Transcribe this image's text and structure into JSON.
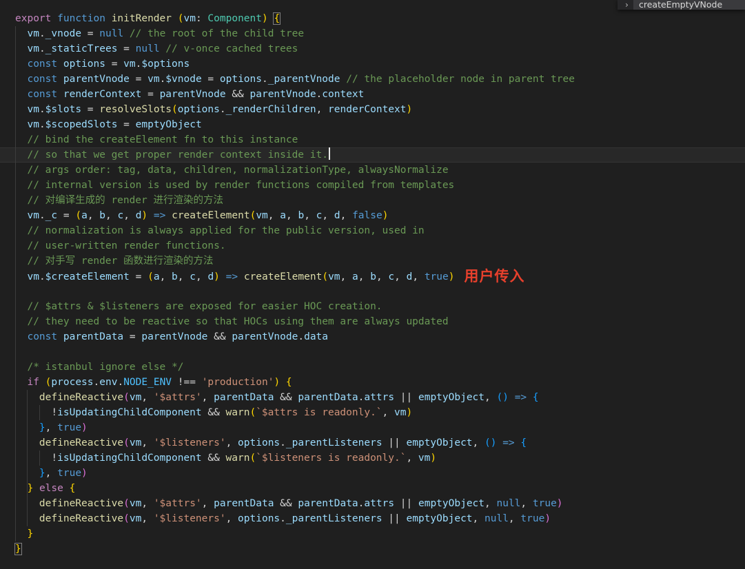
{
  "overlay": {
    "chevron": "›",
    "label": "createEmptyVNode"
  },
  "editor": {
    "cursor_line": 10,
    "palette": {
      "background": "#1f1f1f",
      "pl": "#d4d4d4",
      "cm": "#6a9955",
      "kw": "#569cd6",
      "kw2": "#c586c0",
      "fn": "#dcdcaa",
      "var": "#9cdcfe",
      "type": "#4ec9b0",
      "cons": "#4fc1ff",
      "str": "#ce9178",
      "b1": "#ffd700",
      "b2": "#da70d6",
      "b3": "#179fff",
      "bm": "#ffd700",
      "annot": "#e8402c",
      "cursor": "#e8e8e8",
      "indentGuide": "#3c3c3c",
      "lineHighlightBorder": "#343434"
    },
    "indent_guides": [
      {
        "col": 0,
        "from": 2,
        "to": 35
      },
      {
        "col": 2,
        "from": 26,
        "to": 34
      },
      {
        "col": 4,
        "from": 27,
        "to": 27
      },
      {
        "col": 4,
        "from": 30,
        "to": 30
      }
    ],
    "code_lines": [
      [
        [
          "kw2",
          "export"
        ],
        [
          "pl",
          " "
        ],
        [
          "kw",
          "function"
        ],
        [
          "pl",
          " "
        ],
        [
          "fn",
          "initRender"
        ],
        [
          "pl",
          " "
        ],
        [
          "b1",
          "("
        ],
        [
          "var",
          "vm"
        ],
        [
          "pl",
          ": "
        ],
        [
          "type",
          "Component"
        ],
        [
          "b1",
          ")"
        ],
        [
          "pl",
          " "
        ],
        [
          "bm",
          "{"
        ]
      ],
      [
        [
          "pl",
          "  "
        ],
        [
          "var",
          "vm"
        ],
        [
          "pl",
          "."
        ],
        [
          "var",
          "_vnode"
        ],
        [
          "pl",
          " = "
        ],
        [
          "kw",
          "null"
        ],
        [
          "pl",
          " "
        ],
        [
          "cm",
          "// the root of the child tree"
        ]
      ],
      [
        [
          "pl",
          "  "
        ],
        [
          "var",
          "vm"
        ],
        [
          "pl",
          "."
        ],
        [
          "var",
          "_staticTrees"
        ],
        [
          "pl",
          " = "
        ],
        [
          "kw",
          "null"
        ],
        [
          "pl",
          " "
        ],
        [
          "cm",
          "// v-once cached trees"
        ]
      ],
      [
        [
          "pl",
          "  "
        ],
        [
          "kw",
          "const"
        ],
        [
          "pl",
          " "
        ],
        [
          "var",
          "options"
        ],
        [
          "pl",
          " = "
        ],
        [
          "var",
          "vm"
        ],
        [
          "pl",
          "."
        ],
        [
          "var",
          "$options"
        ]
      ],
      [
        [
          "pl",
          "  "
        ],
        [
          "kw",
          "const"
        ],
        [
          "pl",
          " "
        ],
        [
          "var",
          "parentVnode"
        ],
        [
          "pl",
          " = "
        ],
        [
          "var",
          "vm"
        ],
        [
          "pl",
          "."
        ],
        [
          "var",
          "$vnode"
        ],
        [
          "pl",
          " = "
        ],
        [
          "var",
          "options"
        ],
        [
          "pl",
          "."
        ],
        [
          "var",
          "_parentVnode"
        ],
        [
          "pl",
          " "
        ],
        [
          "cm",
          "// the placeholder node in parent tree"
        ]
      ],
      [
        [
          "pl",
          "  "
        ],
        [
          "kw",
          "const"
        ],
        [
          "pl",
          " "
        ],
        [
          "var",
          "renderContext"
        ],
        [
          "pl",
          " = "
        ],
        [
          "var",
          "parentVnode"
        ],
        [
          "pl",
          " && "
        ],
        [
          "var",
          "parentVnode"
        ],
        [
          "pl",
          "."
        ],
        [
          "var",
          "context"
        ]
      ],
      [
        [
          "pl",
          "  "
        ],
        [
          "var",
          "vm"
        ],
        [
          "pl",
          "."
        ],
        [
          "var",
          "$slots"
        ],
        [
          "pl",
          " = "
        ],
        [
          "fn",
          "resolveSlots"
        ],
        [
          "b1",
          "("
        ],
        [
          "var",
          "options"
        ],
        [
          "pl",
          "."
        ],
        [
          "var",
          "_renderChildren"
        ],
        [
          "pl",
          ", "
        ],
        [
          "var",
          "renderContext"
        ],
        [
          "b1",
          ")"
        ]
      ],
      [
        [
          "pl",
          "  "
        ],
        [
          "var",
          "vm"
        ],
        [
          "pl",
          "."
        ],
        [
          "var",
          "$scopedSlots"
        ],
        [
          "pl",
          " = "
        ],
        [
          "var",
          "emptyObject"
        ]
      ],
      [
        [
          "pl",
          "  "
        ],
        [
          "cm",
          "// bind the createElement fn to this instance"
        ]
      ],
      [
        [
          "pl",
          "  "
        ],
        [
          "cm",
          "// so that we get proper render context inside it."
        ],
        [
          "cur",
          ""
        ]
      ],
      [
        [
          "pl",
          "  "
        ],
        [
          "cm",
          "// args order: tag, data, children, normalizationType, alwaysNormalize"
        ]
      ],
      [
        [
          "pl",
          "  "
        ],
        [
          "cm",
          "// internal version is used by render functions compiled from templates"
        ]
      ],
      [
        [
          "pl",
          "  "
        ],
        [
          "cm",
          "// 对编译生成的 render 进行渲染的方法"
        ]
      ],
      [
        [
          "pl",
          "  "
        ],
        [
          "var",
          "vm"
        ],
        [
          "pl",
          "."
        ],
        [
          "var",
          "_c"
        ],
        [
          "pl",
          " = "
        ],
        [
          "b1",
          "("
        ],
        [
          "var",
          "a"
        ],
        [
          "pl",
          ", "
        ],
        [
          "var",
          "b"
        ],
        [
          "pl",
          ", "
        ],
        [
          "var",
          "c"
        ],
        [
          "pl",
          ", "
        ],
        [
          "var",
          "d"
        ],
        [
          "b1",
          ")"
        ],
        [
          "pl",
          " "
        ],
        [
          "kw",
          "=>"
        ],
        [
          "pl",
          " "
        ],
        [
          "fn",
          "createElement"
        ],
        [
          "b1",
          "("
        ],
        [
          "var",
          "vm"
        ],
        [
          "pl",
          ", "
        ],
        [
          "var",
          "a"
        ],
        [
          "pl",
          ", "
        ],
        [
          "var",
          "b"
        ],
        [
          "pl",
          ", "
        ],
        [
          "var",
          "c"
        ],
        [
          "pl",
          ", "
        ],
        [
          "var",
          "d"
        ],
        [
          "pl",
          ", "
        ],
        [
          "kw",
          "false"
        ],
        [
          "b1",
          ")"
        ]
      ],
      [
        [
          "pl",
          "  "
        ],
        [
          "cm",
          "// normalization is always applied for the public version, used in"
        ]
      ],
      [
        [
          "pl",
          "  "
        ],
        [
          "cm",
          "// user-written render functions."
        ]
      ],
      [
        [
          "pl",
          "  "
        ],
        [
          "cm",
          "// 对手写 render 函数进行渲染的方法"
        ]
      ],
      [
        [
          "pl",
          "  "
        ],
        [
          "var",
          "vm"
        ],
        [
          "pl",
          "."
        ],
        [
          "var",
          "$createElement"
        ],
        [
          "pl",
          " = "
        ],
        [
          "b1",
          "("
        ],
        [
          "var",
          "a"
        ],
        [
          "pl",
          ", "
        ],
        [
          "var",
          "b"
        ],
        [
          "pl",
          ", "
        ],
        [
          "var",
          "c"
        ],
        [
          "pl",
          ", "
        ],
        [
          "var",
          "d"
        ],
        [
          "b1",
          ")"
        ],
        [
          "pl",
          " "
        ],
        [
          "kw",
          "=>"
        ],
        [
          "pl",
          " "
        ],
        [
          "fn",
          "createElement"
        ],
        [
          "b1",
          "("
        ],
        [
          "var",
          "vm"
        ],
        [
          "pl",
          ", "
        ],
        [
          "var",
          "a"
        ],
        [
          "pl",
          ", "
        ],
        [
          "var",
          "b"
        ],
        [
          "pl",
          ", "
        ],
        [
          "var",
          "c"
        ],
        [
          "pl",
          ", "
        ],
        [
          "var",
          "d"
        ],
        [
          "pl",
          ", "
        ],
        [
          "kw",
          "true"
        ],
        [
          "b1",
          ")"
        ],
        [
          "annot",
          "用户传入"
        ]
      ],
      [],
      [
        [
          "pl",
          "  "
        ],
        [
          "cm",
          "// $attrs & $listeners are exposed for easier HOC creation."
        ]
      ],
      [
        [
          "pl",
          "  "
        ],
        [
          "cm",
          "// they need to be reactive so that HOCs using them are always updated"
        ]
      ],
      [
        [
          "pl",
          "  "
        ],
        [
          "kw",
          "const"
        ],
        [
          "pl",
          " "
        ],
        [
          "var",
          "parentData"
        ],
        [
          "pl",
          " = "
        ],
        [
          "var",
          "parentVnode"
        ],
        [
          "pl",
          " && "
        ],
        [
          "var",
          "parentVnode"
        ],
        [
          "pl",
          "."
        ],
        [
          "var",
          "data"
        ]
      ],
      [],
      [
        [
          "pl",
          "  "
        ],
        [
          "cm",
          "/* istanbul ignore else */"
        ]
      ],
      [
        [
          "pl",
          "  "
        ],
        [
          "kw2",
          "if"
        ],
        [
          "pl",
          " "
        ],
        [
          "b1",
          "("
        ],
        [
          "var",
          "process"
        ],
        [
          "pl",
          "."
        ],
        [
          "var",
          "env"
        ],
        [
          "pl",
          "."
        ],
        [
          "cons",
          "NODE_ENV"
        ],
        [
          "pl",
          " !== "
        ],
        [
          "str",
          "'production'"
        ],
        [
          "b1",
          ")"
        ],
        [
          "pl",
          " "
        ],
        [
          "b1",
          "{"
        ]
      ],
      [
        [
          "pl",
          "    "
        ],
        [
          "fn",
          "defineReactive"
        ],
        [
          "b2",
          "("
        ],
        [
          "var",
          "vm"
        ],
        [
          "pl",
          ", "
        ],
        [
          "str",
          "'$attrs'"
        ],
        [
          "pl",
          ", "
        ],
        [
          "var",
          "parentData"
        ],
        [
          "pl",
          " && "
        ],
        [
          "var",
          "parentData"
        ],
        [
          "pl",
          "."
        ],
        [
          "var",
          "attrs"
        ],
        [
          "pl",
          " || "
        ],
        [
          "var",
          "emptyObject"
        ],
        [
          "pl",
          ", "
        ],
        [
          "b3",
          "()"
        ],
        [
          "pl",
          " "
        ],
        [
          "kw",
          "=>"
        ],
        [
          "pl",
          " "
        ],
        [
          "b3",
          "{"
        ]
      ],
      [
        [
          "pl",
          "      !"
        ],
        [
          "var",
          "isUpdatingChildComponent"
        ],
        [
          "pl",
          " && "
        ],
        [
          "fn",
          "warn"
        ],
        [
          "b1",
          "("
        ],
        [
          "str",
          "`$attrs is readonly.`"
        ],
        [
          "pl",
          ", "
        ],
        [
          "var",
          "vm"
        ],
        [
          "b1",
          ")"
        ]
      ],
      [
        [
          "pl",
          "    "
        ],
        [
          "b3",
          "}"
        ],
        [
          "pl",
          ", "
        ],
        [
          "kw",
          "true"
        ],
        [
          "b2",
          ")"
        ]
      ],
      [
        [
          "pl",
          "    "
        ],
        [
          "fn",
          "defineReactive"
        ],
        [
          "b2",
          "("
        ],
        [
          "var",
          "vm"
        ],
        [
          "pl",
          ", "
        ],
        [
          "str",
          "'$listeners'"
        ],
        [
          "pl",
          ", "
        ],
        [
          "var",
          "options"
        ],
        [
          "pl",
          "."
        ],
        [
          "var",
          "_parentListeners"
        ],
        [
          "pl",
          " || "
        ],
        [
          "var",
          "emptyObject"
        ],
        [
          "pl",
          ", "
        ],
        [
          "b3",
          "()"
        ],
        [
          "pl",
          " "
        ],
        [
          "kw",
          "=>"
        ],
        [
          "pl",
          " "
        ],
        [
          "b3",
          "{"
        ]
      ],
      [
        [
          "pl",
          "      !"
        ],
        [
          "var",
          "isUpdatingChildComponent"
        ],
        [
          "pl",
          " && "
        ],
        [
          "fn",
          "warn"
        ],
        [
          "b1",
          "("
        ],
        [
          "str",
          "`$listeners is readonly.`"
        ],
        [
          "pl",
          ", "
        ],
        [
          "var",
          "vm"
        ],
        [
          "b1",
          ")"
        ]
      ],
      [
        [
          "pl",
          "    "
        ],
        [
          "b3",
          "}"
        ],
        [
          "pl",
          ", "
        ],
        [
          "kw",
          "true"
        ],
        [
          "b2",
          ")"
        ]
      ],
      [
        [
          "pl",
          "  "
        ],
        [
          "b1",
          "}"
        ],
        [
          "pl",
          " "
        ],
        [
          "kw2",
          "else"
        ],
        [
          "pl",
          " "
        ],
        [
          "b1",
          "{"
        ]
      ],
      [
        [
          "pl",
          "    "
        ],
        [
          "fn",
          "defineReactive"
        ],
        [
          "b2",
          "("
        ],
        [
          "var",
          "vm"
        ],
        [
          "pl",
          ", "
        ],
        [
          "str",
          "'$attrs'"
        ],
        [
          "pl",
          ", "
        ],
        [
          "var",
          "parentData"
        ],
        [
          "pl",
          " && "
        ],
        [
          "var",
          "parentData"
        ],
        [
          "pl",
          "."
        ],
        [
          "var",
          "attrs"
        ],
        [
          "pl",
          " || "
        ],
        [
          "var",
          "emptyObject"
        ],
        [
          "pl",
          ", "
        ],
        [
          "kw",
          "null"
        ],
        [
          "pl",
          ", "
        ],
        [
          "kw",
          "true"
        ],
        [
          "b2",
          ")"
        ]
      ],
      [
        [
          "pl",
          "    "
        ],
        [
          "fn",
          "defineReactive"
        ],
        [
          "b2",
          "("
        ],
        [
          "var",
          "vm"
        ],
        [
          "pl",
          ", "
        ],
        [
          "str",
          "'$listeners'"
        ],
        [
          "pl",
          ", "
        ],
        [
          "var",
          "options"
        ],
        [
          "pl",
          "."
        ],
        [
          "var",
          "_parentListeners"
        ],
        [
          "pl",
          " || "
        ],
        [
          "var",
          "emptyObject"
        ],
        [
          "pl",
          ", "
        ],
        [
          "kw",
          "null"
        ],
        [
          "pl",
          ", "
        ],
        [
          "kw",
          "true"
        ],
        [
          "b2",
          ")"
        ]
      ],
      [
        [
          "pl",
          "  "
        ],
        [
          "b1",
          "}"
        ]
      ],
      [
        [
          "bm",
          "}"
        ]
      ]
    ]
  }
}
